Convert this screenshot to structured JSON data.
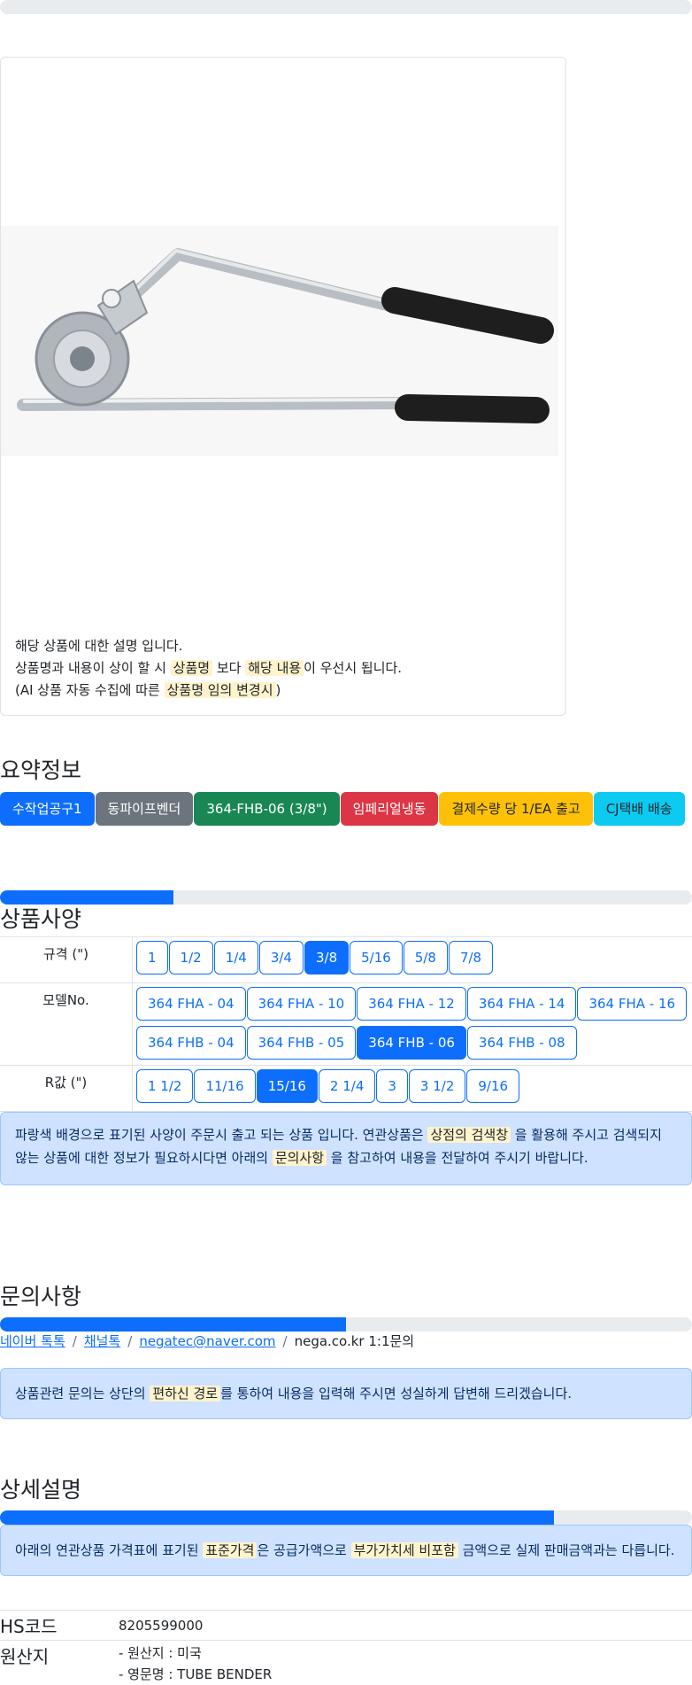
{
  "card": {
    "desc_line1": "해당 상품에 대한 설명 입니다.",
    "desc_line2_a": "상품명과 내용이 상이 할 시 ",
    "desc_line2_hl1": "상품명",
    "desc_line2_b": " 보다 ",
    "desc_line2_hl2": "해당 내용",
    "desc_line2_c": "이 우선시 됩니다.",
    "desc_line3_a": " (AI 상품 자동 수집에 따른 ",
    "desc_line3_hl": "상품명 임의 변경시",
    "desc_line3_b": ")"
  },
  "summary": {
    "title": "요약정보",
    "badges": [
      "수작업공구1",
      "동파이프벤더",
      "364-FHB-06 (3/8\")",
      "임페리얼냉동",
      "결제수량 당 1/EA 출고",
      "CJ택배 배송"
    ]
  },
  "specs": {
    "title": "상품사양",
    "progress": 0.25,
    "rows": [
      {
        "label": "규격 (\")",
        "options": [
          "1",
          "1/2",
          "1/4",
          "3/4",
          "3/8",
          "5/16",
          "5/8",
          "7/8"
        ],
        "selected": 4
      },
      {
        "label": "모델No.",
        "options": [
          "364 FHA - 04",
          "364 FHA - 10",
          "364 FHA - 12",
          "364 FHA - 14",
          "364 FHA - 16",
          "364 FHB - 04",
          "364 FHB - 05",
          "364 FHB - 06",
          "364 FHB - 08"
        ],
        "selected": 7
      },
      {
        "label": "R값 (\")",
        "options": [
          "1 1/2",
          "11/16",
          "15/16",
          "2 1/4",
          "3",
          "3 1/2",
          "9/16"
        ],
        "selected": 2
      }
    ],
    "notice_a": "파랑색 배경으로 표기된 사양이 주문시 출고 되는 상품 입니다. 연관상품은 ",
    "notice_hl1": "상점의 검색창",
    "notice_b": " 을 활용해 주시고 검색되지 않는 상품에 대한 정보가 필요하시다면 아래의 ",
    "notice_hl2": "문의사항",
    "notice_c": " 을 참고하여 내용을 전달하여 주시기 바랍니다."
  },
  "inquiry": {
    "title": "문의사항",
    "progress": 0.5,
    "link_naver": "네이버 톡톡",
    "link_channel": "채널톡",
    "link_email": "negatec@naver.com",
    "text_site": "nega.co.kr 1:1문의",
    "notice_a": "상품관련 문의는 상단의 ",
    "notice_hl": "편하신 경로",
    "notice_b": "를 통하여 내용을 입력해 주시면 성실하게 답변해 드리겠습니다."
  },
  "detail": {
    "title": "상세설명",
    "progress": 0.8,
    "notice_a": "아래의 연관상품 가격표에 표기된 ",
    "notice_hl1": "표준가격",
    "notice_b": "은 공급가액으로 ",
    "notice_hl2": "부가가치세 비포함",
    "notice_c": " 금액으로 실제 판매금액과는 다릅니다.",
    "hs_label": "HS코드",
    "hs_value": "8205599000",
    "origin_label": "원산지",
    "origin_line1": "- 원산지 : 미국",
    "origin_line2": "- 영문명 : TUBE BENDER"
  }
}
